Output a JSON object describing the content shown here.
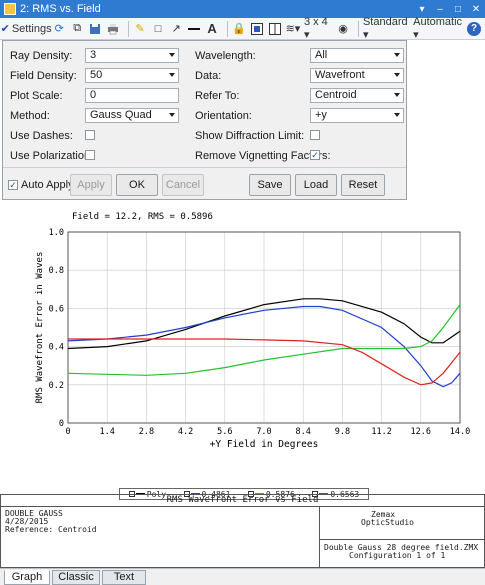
{
  "window": {
    "title": "2: RMS vs. Field"
  },
  "toolbar": {
    "settings_label": "Settings",
    "grid_label": "3 x 4 ▾",
    "standard_label": "Standard ▾",
    "automatic_label": "Automatic ▾"
  },
  "settings": {
    "ray_density_label": "Ray Density:",
    "ray_density_value": "3",
    "field_density_label": "Field Density:",
    "field_density_value": "50",
    "plot_scale_label": "Plot Scale:",
    "plot_scale_value": "0",
    "method_label": "Method:",
    "method_value": "Gauss Quad",
    "use_dashes_label": "Use Dashes:",
    "use_dashes_checked": "",
    "use_polarization_label": "Use Polarization:",
    "use_polarization_checked": "",
    "wavelength_label": "Wavelength:",
    "wavelength_value": "All",
    "data_label": "Data:",
    "data_value": "Wavefront",
    "refer_to_label": "Refer To:",
    "refer_to_value": "Centroid",
    "orientation_label": "Orientation:",
    "orientation_value": "+y",
    "show_diffraction_label": "Show Diffraction Limit:",
    "show_diffraction_checked": "",
    "remove_vignetting_label": "Remove Vignetting Factors:",
    "remove_vignetting_checked": "✓",
    "auto_apply_label": "Auto Apply",
    "auto_apply_checked": "✓",
    "apply_label": "Apply",
    "ok_label": "OK",
    "cancel_label": "Cancel",
    "save_label": "Save",
    "load_label": "Load",
    "reset_label": "Reset"
  },
  "plot": {
    "field_caption": "Field = 12.2, RMS = 0.5896"
  },
  "chart_data": {
    "type": "line",
    "xlabel": "+Y Field in Degrees",
    "ylabel": "RMS Wavefront Error in Waves",
    "xlim": [
      0,
      14.0
    ],
    "ylim": [
      0,
      1.0
    ],
    "x_ticks": [
      "0",
      "1.4",
      "2.8",
      "4.2",
      "5.6",
      "7.0",
      "8.4",
      "9.8",
      "11.2",
      "12.6",
      "14.0"
    ],
    "y_ticks": [
      "0",
      "0.2",
      "0.4",
      "0.6",
      "0.8",
      "1.0"
    ],
    "grid": true,
    "legend_placement": "bottom",
    "series": [
      {
        "name": "Poly",
        "color": "#000000",
        "x": [
          0,
          1.4,
          2.8,
          4.2,
          5.6,
          7.0,
          8.4,
          9.0,
          9.8,
          11.2,
          12.0,
          12.6,
          13.0,
          13.4,
          14.0
        ],
        "y": [
          0.39,
          0.4,
          0.43,
          0.49,
          0.56,
          0.62,
          0.65,
          0.65,
          0.64,
          0.58,
          0.52,
          0.45,
          0.42,
          0.42,
          0.48
        ]
      },
      {
        "name": "0.4861",
        "color": "#1f3fd1",
        "x": [
          0,
          1.4,
          2.8,
          4.2,
          5.6,
          7.0,
          8.4,
          9.0,
          9.8,
          11.2,
          12.0,
          12.6,
          13.0,
          13.4,
          13.7,
          14.0
        ],
        "y": [
          0.43,
          0.44,
          0.46,
          0.5,
          0.55,
          0.59,
          0.61,
          0.61,
          0.59,
          0.5,
          0.4,
          0.3,
          0.22,
          0.19,
          0.21,
          0.26
        ]
      },
      {
        "name": "0.5876",
        "color": "#22c22a",
        "x": [
          0,
          1.4,
          2.8,
          4.2,
          5.6,
          7.0,
          8.4,
          9.8,
          11.2,
          12.0,
          12.6,
          13.0,
          13.4,
          14.0
        ],
        "y": [
          0.26,
          0.255,
          0.25,
          0.26,
          0.29,
          0.33,
          0.36,
          0.39,
          0.39,
          0.39,
          0.4,
          0.43,
          0.5,
          0.62
        ]
      },
      {
        "name": "0.6563",
        "color": "#e02020",
        "x": [
          0,
          1.4,
          2.8,
          4.2,
          5.6,
          7.0,
          8.4,
          9.8,
          10.5,
          11.2,
          12.0,
          12.6,
          13.0,
          13.4,
          14.0
        ],
        "y": [
          0.44,
          0.44,
          0.44,
          0.44,
          0.44,
          0.435,
          0.43,
          0.41,
          0.37,
          0.31,
          0.24,
          0.2,
          0.21,
          0.26,
          0.37
        ]
      }
    ]
  },
  "info": {
    "header": "RMS Wavefront Error vs Field",
    "line1": "DOUBLE GAUSS",
    "line2": "4/28/2015",
    "line3": "Reference: Centroid",
    "company1": "Zemax",
    "company2": "OpticStudio",
    "file1": "Double Gauss 28 degree field.ZMX",
    "file2": "Configuration 1 of 1"
  },
  "tabs": [
    {
      "label": "Graph"
    },
    {
      "label": "Classic"
    },
    {
      "label": "Text"
    }
  ]
}
